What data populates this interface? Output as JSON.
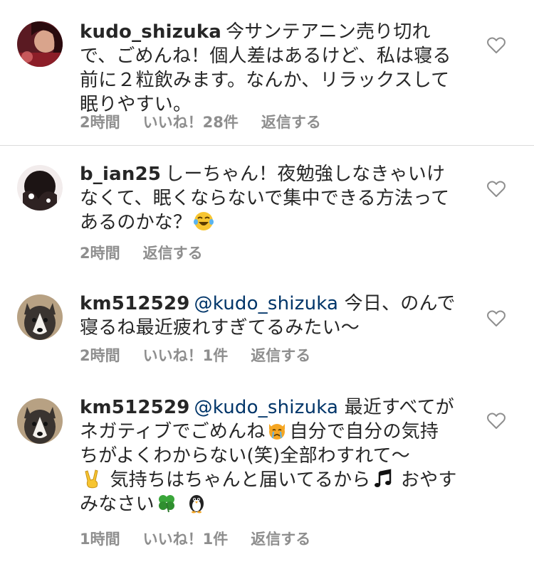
{
  "comments": [
    {
      "username": "kudo_shizuka",
      "text": "今サンテアニン売り切れで、ごめんね！個人差はあるけど、私は寝る前に２粒飲みます。なんか、リラックスして眠りやすい。",
      "time": "2時間",
      "likes": "いいね！28件",
      "reply": "返信する"
    },
    {
      "username": "b_ian25",
      "text": "しーちゃん！夜勉強しなきゃいけなくて、眠くならないで集中できる方法ってあるのかな？",
      "emoji_after": "laughing-crying-emoji",
      "time": "2時間",
      "reply": "返信する"
    },
    {
      "username": "km512529",
      "mention": "@kudo_shizuka",
      "text": "今日、のんで寝るね最近疲れすぎてるみたい〜",
      "time": "2時間",
      "likes": "いいね！1件",
      "reply": "返信する"
    },
    {
      "username": "km512529",
      "mention": "@kudo_shizuka",
      "text_part1": "最近すべてがネガティブでごめんね",
      "text_part2": "自分で自分の気持ちがよくわからない(笑)全部わすれて〜",
      "text_part3": "気持ちはちゃんと届いてるから",
      "text_part4": "おやすみなさい",
      "time": "1時間",
      "likes": "いいね！1件",
      "reply": "返信する"
    }
  ],
  "icons": {
    "heart": "heart-outline-icon",
    "emoji_cry_cat": "crying-cat-emoji",
    "emoji_victory": "victory-hand-emoji",
    "emoji_note": "musical-notes-emoji",
    "emoji_clover": "four-leaf-clover-emoji",
    "emoji_penguin": "penguin-emoji"
  },
  "colors": {
    "text": "#262626",
    "meta": "#8e8e8e",
    "mention": "#003569",
    "divider": "#dbdbdb"
  }
}
